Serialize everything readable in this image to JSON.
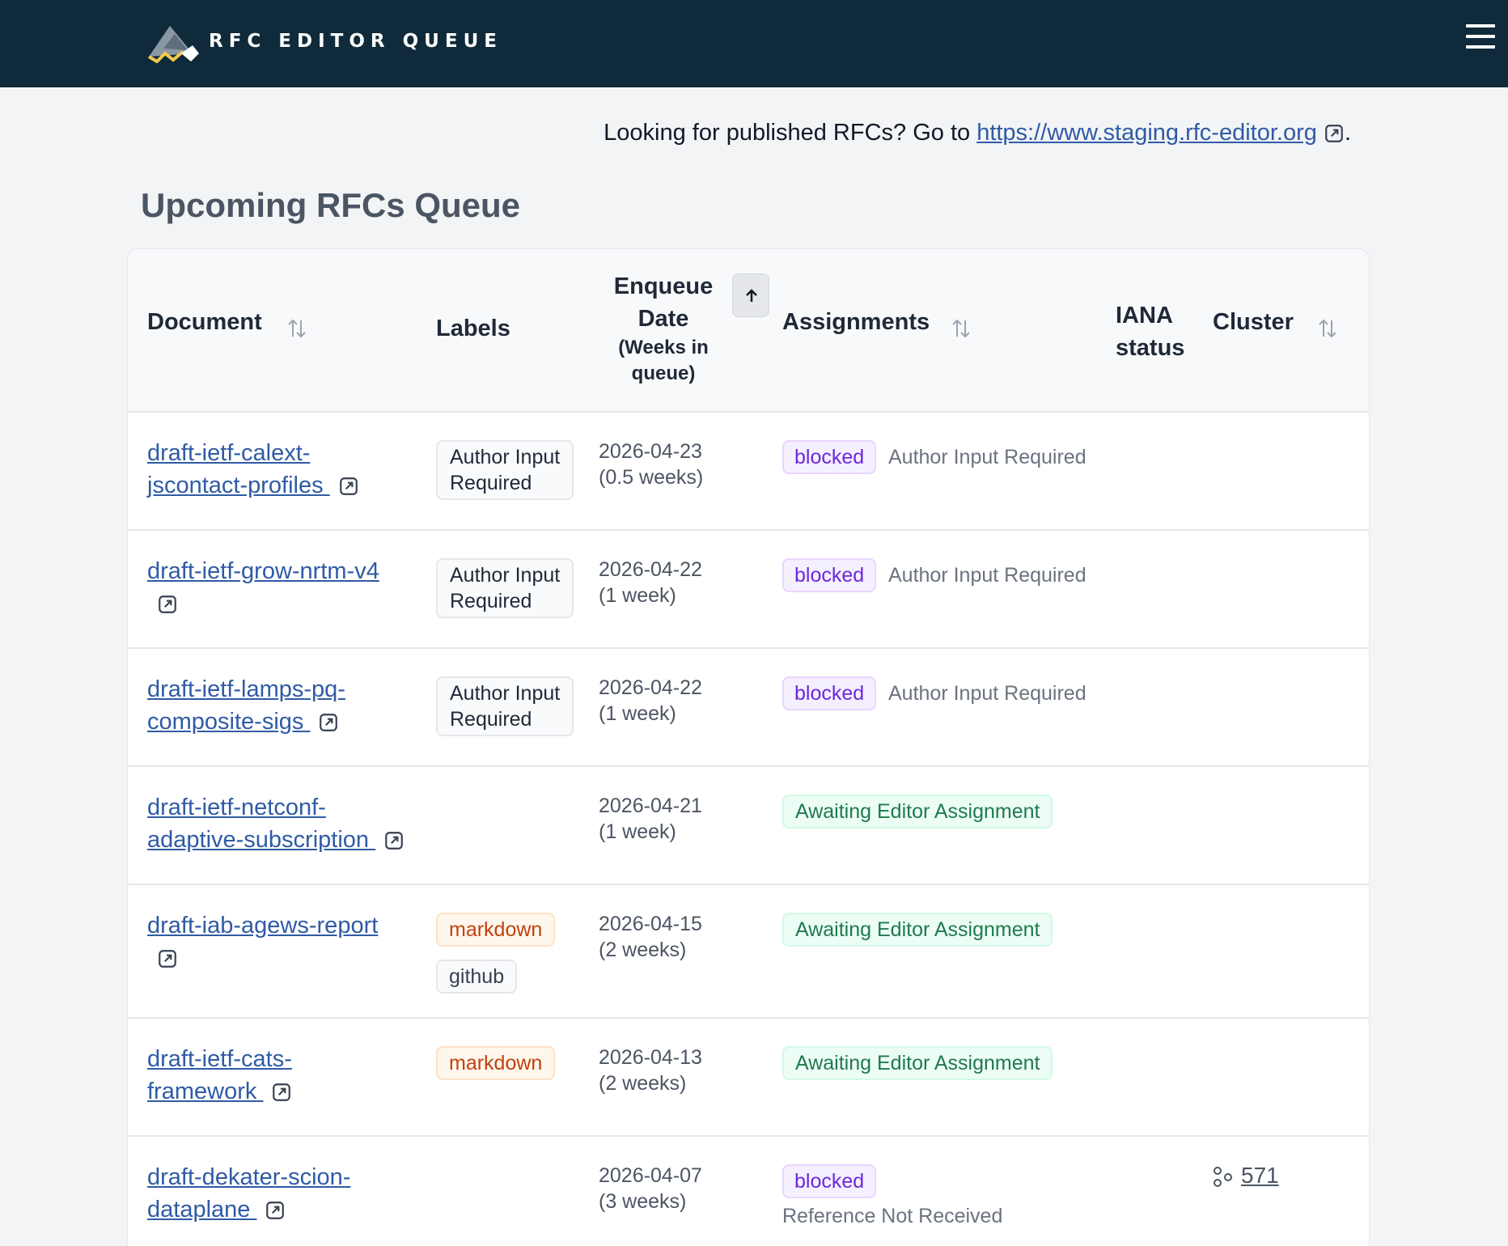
{
  "header": {
    "brand": "RFC EDITOR QUEUE",
    "logo_icon": "rfc-editor-mountain-logo",
    "menu_icon": "hamburger-menu-icon"
  },
  "notice": {
    "prefix": "Looking for published RFCs? Go to ",
    "link_text": "https://www.staging.rfc-editor.org",
    "suffix": "."
  },
  "page_title": "Upcoming RFCs Queue",
  "table": {
    "headers": {
      "document": "Document",
      "labels": "Labels",
      "enqueue_date_line1": "Enqueue",
      "enqueue_date_line2": "Date",
      "enqueue_sub1": "(Weeks in",
      "enqueue_sub2": "queue)",
      "assignments": "Assignments",
      "iana_line1": "IANA",
      "iana_line2": "status",
      "cluster": "Cluster"
    },
    "rows": [
      {
        "doc_line1": "draft-ietf-calext-",
        "doc_line2": "jscontact-profiles",
        "label": "Author Input",
        "label2": "Required",
        "date": "2026-04-23",
        "weeks": "(0.5 weeks)",
        "badge": "blocked",
        "assign": "Author Input Required"
      },
      {
        "doc_line1": "draft-ietf-grow-nrtm-v4",
        "label": "Author Input",
        "label2": "Required",
        "date": "2026-04-22",
        "weeks": "(1 week)",
        "badge": "blocked",
        "assign": "Author Input Required"
      },
      {
        "doc_line1": "draft-ietf-lamps-pq-",
        "doc_line2": "composite-sigs",
        "label": "Author Input",
        "label2": "Required",
        "date": "2026-04-22",
        "weeks": "(1 week)",
        "badge": "blocked",
        "assign": "Author Input Required"
      },
      {
        "doc_line1": "draft-ietf-netconf-",
        "doc_line2": "adaptive-subscription",
        "date": "2026-04-21",
        "weeks": "(1 week)",
        "badge": "Awaiting Editor Assignment"
      },
      {
        "doc_line1": "draft-iab-agews-report",
        "label_a": "markdown",
        "label_b": "github",
        "date": "2026-04-15",
        "weeks": "(2 weeks)",
        "badge": "Awaiting Editor Assignment"
      },
      {
        "doc_line1": "draft-ietf-cats-",
        "doc_line2": "framework",
        "label_a": "markdown",
        "date": "2026-04-13",
        "weeks": "(2 weeks)",
        "badge": "Awaiting Editor Assignment"
      },
      {
        "doc_line1": "draft-dekater-scion-",
        "doc_line2": "dataplane",
        "date": "2026-04-07",
        "weeks": "(3 weeks)",
        "badge": "blocked",
        "assign": "Reference Not Received",
        "cluster": "571"
      }
    ]
  },
  "colors": {
    "topbar": "#0f2a3a",
    "link": "#2f5ba5",
    "blocked": "#6d28d9",
    "awaiting": "#1f7a4d",
    "markdown": "#c2410c"
  }
}
